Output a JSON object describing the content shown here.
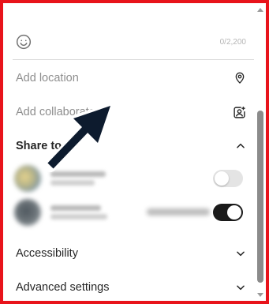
{
  "caption": {
    "char_count": "0/2,200",
    "emoji_icon": "smiley-icon"
  },
  "options": {
    "add_location": "Add location",
    "location_icon": "map-pin-icon",
    "add_collaborators": "Add collaborators",
    "collaborators_icon": "add-person-icon"
  },
  "share": {
    "label": "Share to",
    "accounts": [
      {
        "toggle_on": false
      },
      {
        "toggle_on": true
      }
    ]
  },
  "sections": {
    "accessibility": "Accessibility",
    "advanced": "Advanced settings"
  },
  "overlay": {
    "arrow_color": "#0d1b2e"
  },
  "colors": {
    "frame_border": "#e8131b",
    "toggle_on": "#1a1a1a",
    "toggle_off": "#e4e4e4"
  }
}
